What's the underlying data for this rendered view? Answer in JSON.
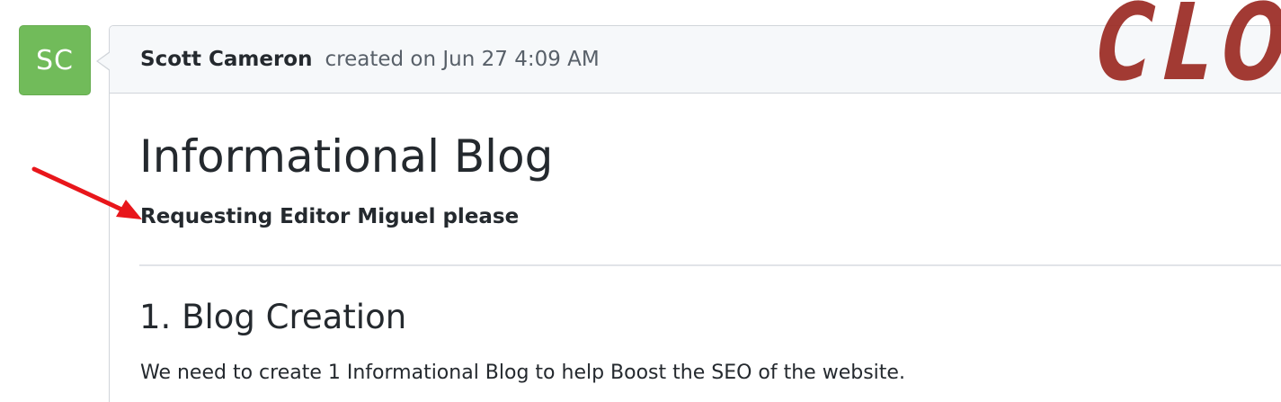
{
  "comment": {
    "avatar_initials": "SC",
    "avatar_color": "#71bb5a",
    "author": "Scott Cameron",
    "created_text": "created on Jun 27 4:09 AM"
  },
  "body": {
    "title": "Informational Blog",
    "subtitle": "Requesting Editor Miguel please",
    "section_heading": "1. Blog Creation",
    "paragraph": "We need to create 1 Informational Blog to help Boost the SEO of the website."
  },
  "overlay": {
    "stamp_text": "CLO",
    "stamp_color": "#9b2a23",
    "arrow_color": "#e8161b"
  }
}
